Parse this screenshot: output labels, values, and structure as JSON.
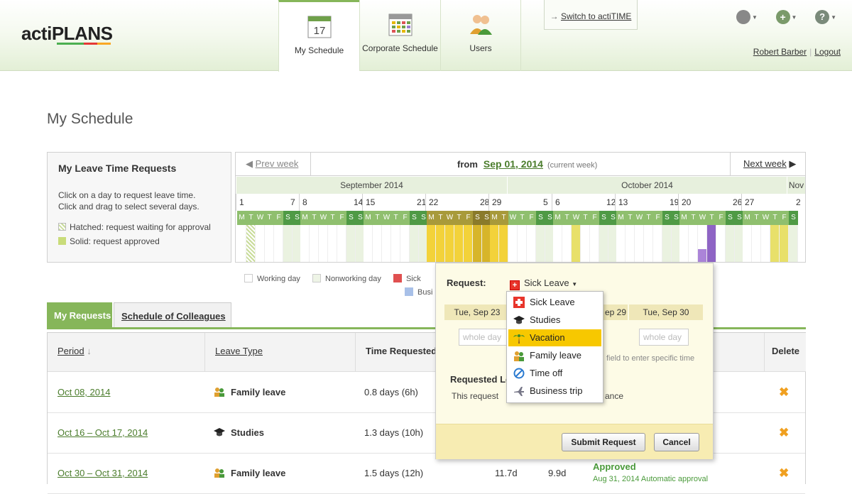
{
  "app": {
    "logo_prefix": "acti",
    "logo_suffix": "PLANS"
  },
  "nav": {
    "tabs": [
      {
        "label": "My Schedule",
        "calendar_day": "17"
      },
      {
        "label": "Corporate Schedule"
      },
      {
        "label": "Users"
      }
    ],
    "switch_label": "Switch to actiTIME",
    "user_name": "Robert Barber",
    "logout_label": "Logout"
  },
  "page": {
    "title": "My Schedule"
  },
  "leave_box": {
    "title": "My Leave Time Requests",
    "line1": "Click on a day to request leave time.",
    "line2": "Click and drag to select several days.",
    "legend_hatched": "Hatched: request waiting for approval",
    "legend_solid": "Solid: request approved"
  },
  "calendar": {
    "prev_label": "Prev week",
    "next_label": "Next week",
    "from_label": "from",
    "from_date": "Sep 01, 2014",
    "current_week": "(current week)",
    "months": [
      "September 2014",
      "October 2014",
      "Nov"
    ],
    "dates": [
      "1",
      "7",
      "8",
      "14",
      "15",
      "21",
      "22",
      "28",
      "29",
      "5",
      "6",
      "12",
      "13",
      "19",
      "20",
      "26",
      "27",
      "2"
    ],
    "dow_letters": [
      "M",
      "T",
      "W",
      "T",
      "F",
      "S",
      "S"
    ]
  },
  "day_legend": {
    "working": "Working day",
    "nonworking": "Nonworking day",
    "sick": "Sick",
    "business": "Busi"
  },
  "tabs": {
    "my_requests": "My Requests",
    "colleagues": "Schedule of Colleagues"
  },
  "table": {
    "headers": {
      "period": "Period",
      "leave_type": "Leave Type",
      "time_requested": "Time Requested",
      "delete": "Delete"
    },
    "rows": [
      {
        "period": "Oct 08, 2014",
        "type": "Family leave",
        "time": "0.8 days (6h)"
      },
      {
        "period": "Oct 16 – Oct 17, 2014",
        "type": "Studies",
        "time": "1.3 days (10h)"
      },
      {
        "period": "Oct 30 – Oct 31, 2014",
        "type": "Family leave",
        "time": "1.5 days (12h)",
        "col4": "11.7d",
        "col5": "9.9d",
        "status": "Approved",
        "status_note": "Aug 31, 2014 Automatic approval"
      }
    ]
  },
  "popup": {
    "request_label": "Request:",
    "selected_type": "Sick Leave",
    "day1": "Tue, Sep 23",
    "day2_partial": "ep 29",
    "day3": "Tue, Sep 30",
    "whole_day": "whole day",
    "hint": "field to enter specific time",
    "requested_label": "Requested Le",
    "note": "This request",
    "note_tail": "ance",
    "submit": "Submit Request",
    "cancel": "Cancel"
  },
  "dropdown": {
    "items": [
      "Sick Leave",
      "Studies",
      "Vacation",
      "Family leave",
      "Time off",
      "Business trip"
    ],
    "selected_index": 2
  }
}
